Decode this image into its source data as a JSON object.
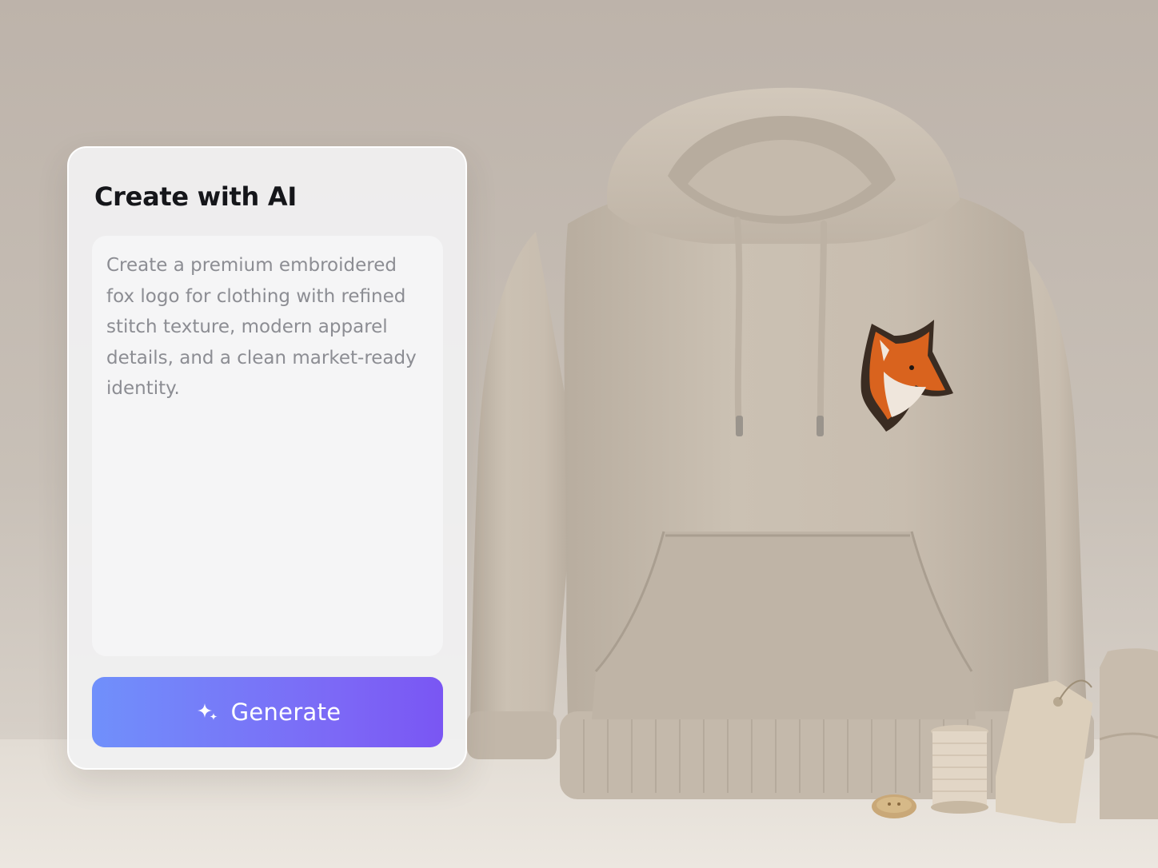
{
  "panel": {
    "title": "Create with AI",
    "prompt_text": "Create a premium embroidered fox logo for clothing with refined stitch texture, modern apparel details, and a clean market-ready identity.",
    "generate_label": "Generate",
    "generate_icon": "sparkle-icon"
  },
  "colors": {
    "button_gradient_start": "#7090fb",
    "button_gradient_end": "#7a56f3",
    "hoodie": "#c9beaf",
    "fox_orange": "#d9631e"
  }
}
